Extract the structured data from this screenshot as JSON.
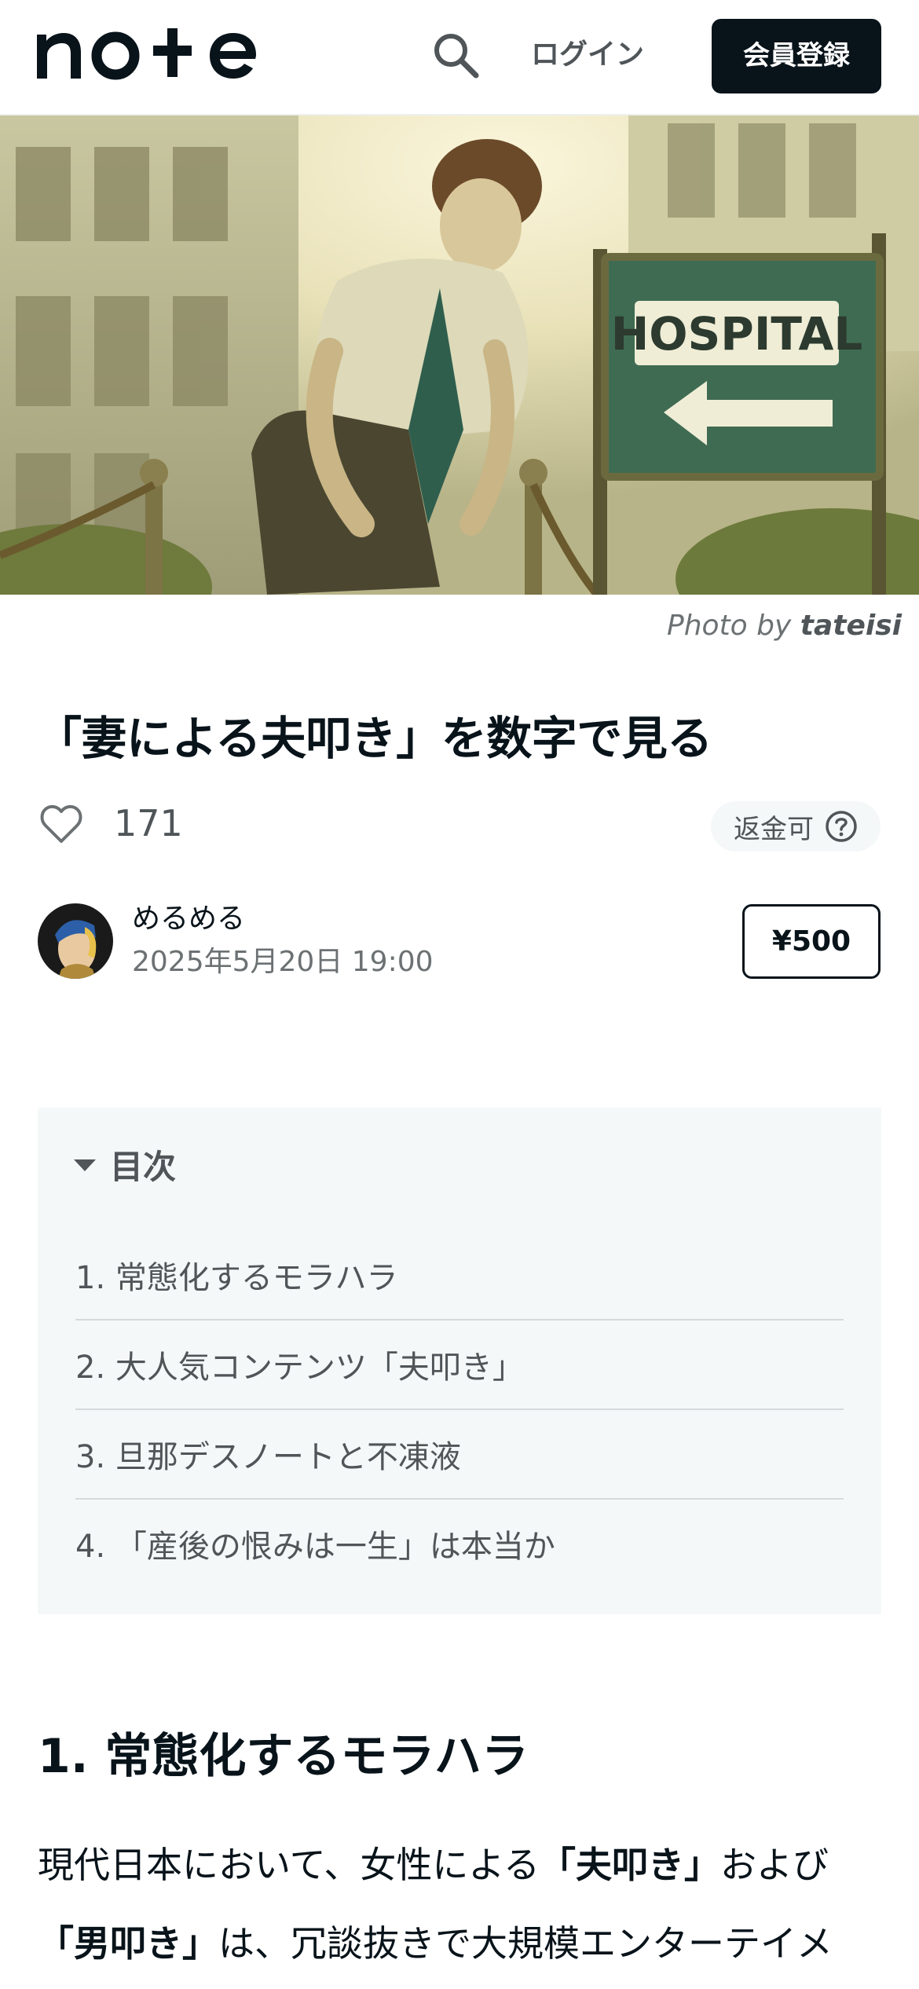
{
  "header": {
    "logo_text": "note",
    "login_label": "ログイン",
    "signup_label": "会員登録",
    "icons": {
      "search": "search-icon"
    }
  },
  "hero": {
    "sign_text": "HOSPITAL",
    "credit_prefix": "Photo by",
    "credit_author": "tateisi"
  },
  "article": {
    "title": "「妻による夫叩き」を数字で見る",
    "like_count": "171",
    "refund_label": "返金可",
    "author_name": "めるめる",
    "published": "2025年5月20日 19:00",
    "price": "¥500"
  },
  "toc": {
    "title": "目次",
    "items": [
      "1. 常態化するモラハラ",
      "2. 大人気コンテンツ「夫叩き」",
      "3. 旦那デスノートと不凍液",
      "4. 「産後の恨みは一生」は本当か"
    ]
  },
  "section": {
    "heading": "1. 常態化するモラハラ",
    "body": {
      "p1": "現代日本において、女性による",
      "b1": "「夫叩き」",
      "p2": "および",
      "b2": "「男叩き」",
      "p3": "は、冗談抜きで大規模エンターテイメ"
    }
  },
  "colors": {
    "brand_dark": "#08131a",
    "muted_text": "#4f5558",
    "toc_background": "#f5f8f8",
    "sign_green": "#3f6b52"
  }
}
